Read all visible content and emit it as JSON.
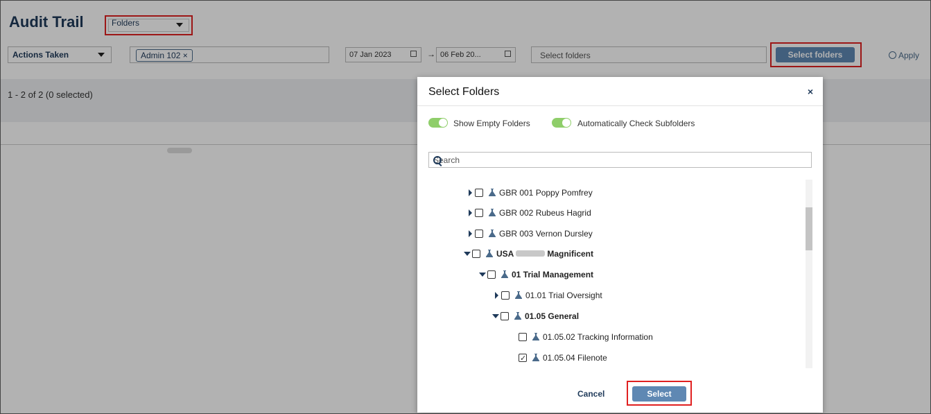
{
  "header": {
    "title": "Audit Trail",
    "view_select": "Folders"
  },
  "filters": {
    "action_select": "Actions Taken",
    "user_tag": "Admin 102 ×",
    "date_from": "07 Jan 2023",
    "date_arrow": "→",
    "date_to": "06 Feb 20...",
    "folder_placeholder": "Select folders",
    "select_folders_button": "Select folders",
    "apply_label": "Apply"
  },
  "results": {
    "count": "1 - 2 of 2 (0 selected)"
  },
  "dialog": {
    "title": "Select Folders",
    "close": "×",
    "toggle_empty": "Show Empty Folders",
    "toggle_subfolders": "Automatically Check Subfolders",
    "search_placeholder": "Search",
    "tree": [
      {
        "label": "GBR 001 Poppy Pomfrey",
        "expanded": false,
        "checked": false
      },
      {
        "label": "GBR 002 Rubeus Hagrid",
        "expanded": false,
        "checked": false
      },
      {
        "label": "GBR 003 Vernon Dursley",
        "expanded": false,
        "checked": false
      },
      {
        "label_prefix": "USA",
        "label_suffix": "Magnificent",
        "expanded": true,
        "checked": false
      },
      {
        "label": "01 Trial Management",
        "expanded": true,
        "checked": false
      },
      {
        "label": "01.01 Trial Oversight",
        "expanded": false,
        "checked": false
      },
      {
        "label": "01.05 General",
        "expanded": true,
        "checked": false
      },
      {
        "label": "01.05.02 Tracking Information",
        "checked": false
      },
      {
        "label": "01.05.04 Filenote",
        "checked": true
      }
    ],
    "cancel_label": "Cancel",
    "select_label": "Select"
  },
  "colors": {
    "accent": "#5f88b3",
    "highlight": "#e02020",
    "toggle_on": "#8fce6a"
  }
}
